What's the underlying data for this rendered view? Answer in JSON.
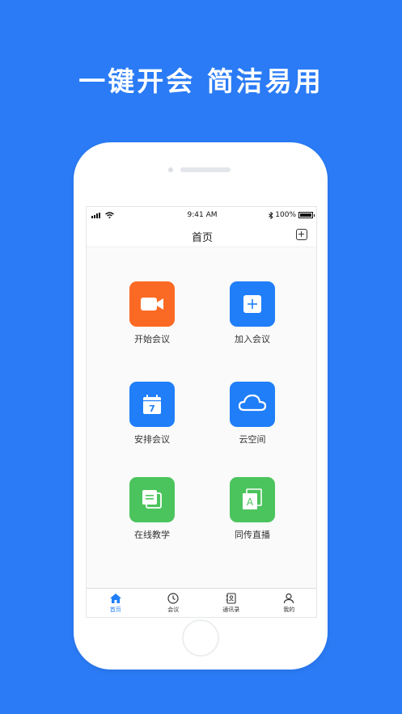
{
  "headline": "一键开会  简洁易用",
  "status_bar": {
    "time": "9:41 AM",
    "battery": "100%"
  },
  "nav": {
    "title": "首页"
  },
  "tiles": [
    {
      "label": "开始会议",
      "icon": "video-camera-icon",
      "color": "#fb6a24"
    },
    {
      "label": "加入会议",
      "icon": "plus-square-icon",
      "color": "#1f7ef8"
    },
    {
      "label": "安排会议",
      "icon": "calendar-icon",
      "color": "#1f7ef8",
      "badge": "7"
    },
    {
      "label": "云空间",
      "icon": "cloud-icon",
      "color": "#1f7ef8"
    },
    {
      "label": "在线教学",
      "icon": "document-stack-icon",
      "color": "#4bc45d"
    },
    {
      "label": "同传直播",
      "icon": "letter-a-icon",
      "color": "#4bc45d",
      "badge": "A"
    }
  ],
  "tabs": [
    {
      "label": "首页",
      "icon": "home-icon",
      "active": true
    },
    {
      "label": "会议",
      "icon": "clock-icon",
      "active": false
    },
    {
      "label": "通讯录",
      "icon": "contacts-icon",
      "active": false
    },
    {
      "label": "我的",
      "icon": "person-icon",
      "active": false
    }
  ]
}
